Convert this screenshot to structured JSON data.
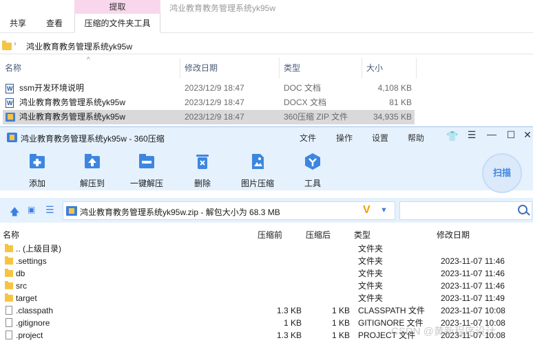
{
  "explorer": {
    "context_tab_header": "提取",
    "window_title": "鸿业教育教务管理系统yk95w",
    "tabs": [
      {
        "label": "共享"
      },
      {
        "label": "查看"
      },
      {
        "label": "压缩的文件夹工具"
      }
    ],
    "address": "鸿业教育教务管理系统yk95w",
    "columns": [
      "名称",
      "修改日期",
      "类型",
      "大小"
    ],
    "files": [
      {
        "name": "ssm开发环境说明",
        "date": "2023/12/9 18:47",
        "type": "DOC 文档",
        "size": "4,108 KB",
        "icon": "word-doc-icon"
      },
      {
        "name": "鸿业教育教务管理系统yk95w",
        "date": "2023/12/9 18:47",
        "type": "DOCX 文档",
        "size": "81 KB",
        "icon": "word-doc-icon"
      },
      {
        "name": "鸿业教育教务管理系统yk95w",
        "date": "2023/12/9 18:47",
        "type": "360压缩 ZIP 文件",
        "size": "34,935 KB",
        "icon": "zip-archive-icon",
        "selected": true
      }
    ]
  },
  "zip": {
    "title": "鸿业教育教务管理系统yk95w - 360压缩",
    "menu": [
      "文件",
      "操作",
      "设置",
      "帮助"
    ],
    "toolbar": [
      {
        "label": "添加",
        "icon": "add-icon"
      },
      {
        "label": "解压到",
        "icon": "extract-to-icon"
      },
      {
        "label": "一键解压",
        "icon": "one-click-extract-icon"
      },
      {
        "label": "删除",
        "icon": "delete-icon"
      },
      {
        "label": "图片压缩",
        "icon": "image-compress-icon"
      },
      {
        "label": "工具",
        "icon": "tools-icon"
      }
    ],
    "scan_label": "扫描",
    "address": "鸿业教育教务管理系统yk95w.zip - 解包大小为 68.3 MB",
    "columns": [
      "名称",
      "压缩前",
      "压缩后",
      "类型",
      "修改日期"
    ],
    "rows": [
      {
        "name": ".. (上级目录)",
        "before": "",
        "after": "",
        "type": "文件夹",
        "date": "",
        "kind": "folder"
      },
      {
        "name": ".settings",
        "before": "",
        "after": "",
        "type": "文件夹",
        "date": "2023-11-07 11:46",
        "kind": "folder"
      },
      {
        "name": "db",
        "before": "",
        "after": "",
        "type": "文件夹",
        "date": "2023-11-07 11:46",
        "kind": "folder"
      },
      {
        "name": "src",
        "before": "",
        "after": "",
        "type": "文件夹",
        "date": "2023-11-07 11:46",
        "kind": "folder"
      },
      {
        "name": "target",
        "before": "",
        "after": "",
        "type": "文件夹",
        "date": "2023-11-07 11:49",
        "kind": "folder"
      },
      {
        "name": ".classpath",
        "before": "1.3 KB",
        "after": "1 KB",
        "type": "CLASSPATH 文件",
        "date": "2023-11-07 10:08",
        "kind": "file"
      },
      {
        "name": ".gitignore",
        "before": "1 KB",
        "after": "1 KB",
        "type": "GITIGNORE 文件",
        "date": "2023-11-07 10:08",
        "kind": "file"
      },
      {
        "name": ".project",
        "before": "1.3 KB",
        "after": "1 KB",
        "type": "PROJECT 文件",
        "date": "2023-11-07 10:08",
        "kind": "file"
      }
    ]
  },
  "watermark": "CSDN @黄新程序设计",
  "colors": {
    "ribbon_context": "#f8d7ec",
    "zip_chrome": "#e5f1fd",
    "accent_blue": "#3d7fe0",
    "selection": "#d9d9d9"
  }
}
